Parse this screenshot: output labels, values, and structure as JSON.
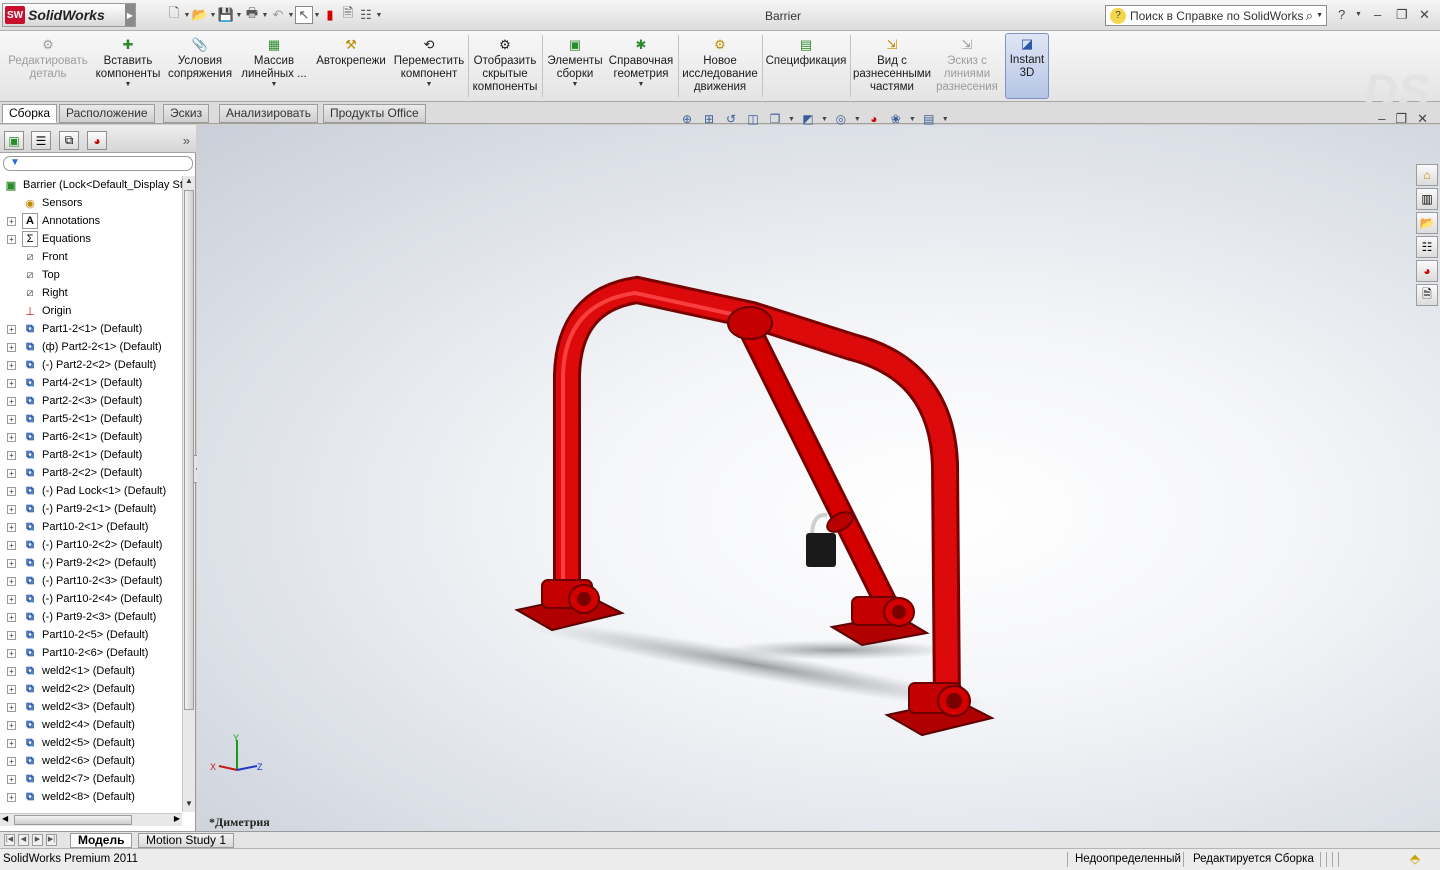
{
  "app": {
    "name": "SolidWorks",
    "logo_text": "SW",
    "window_title": "Barrier"
  },
  "help_search": {
    "placeholder": "Поиск в Справке по SolidWorks"
  },
  "ribbon": {
    "buttons": [
      {
        "label": "Редактировать деталь",
        "icon": "edit-part-icon",
        "disabled": true
      },
      {
        "label": "Вставить компоненты",
        "icon": "insert-component-icon"
      },
      {
        "label": "Условия сопряжения",
        "icon": "mate-icon"
      },
      {
        "label": "Массив линейных ...",
        "icon": "linear-pattern-icon"
      },
      {
        "label": "Автокрепежи",
        "icon": "smart-fasteners-icon"
      },
      {
        "label": "Переместить компонент",
        "icon": "move-component-icon"
      },
      {
        "label": "Отобразить скрытые компоненты",
        "icon": "show-hidden-icon"
      },
      {
        "label": "Элементы сборки",
        "icon": "assembly-features-icon"
      },
      {
        "label": "Справочная геометрия",
        "icon": "reference-geometry-icon"
      },
      {
        "label": "Новое исследование движения",
        "icon": "motion-study-icon"
      },
      {
        "label": "Спецификация",
        "icon": "bom-icon"
      },
      {
        "label": "Вид с разнесенными частями",
        "icon": "exploded-view-icon"
      },
      {
        "label": "Эскиз с линиями разнесения",
        "icon": "explode-line-sketch-icon",
        "disabled": true
      },
      {
        "label": "Instant 3D",
        "icon": "instant3d-icon",
        "active": true
      }
    ]
  },
  "tabs": [
    "Сборка",
    "Расположение",
    "Эскиз",
    "Анализировать",
    "Продукты Office"
  ],
  "tree": {
    "root": "Barrier  (Lock<Default_Display St",
    "items": [
      {
        "label": "Sensors",
        "type": "sensors"
      },
      {
        "label": "Annotations",
        "type": "annotations"
      },
      {
        "label": "Equations",
        "type": "equations"
      },
      {
        "label": "Front",
        "type": "plane"
      },
      {
        "label": "Top",
        "type": "plane"
      },
      {
        "label": "Right",
        "type": "plane"
      },
      {
        "label": "Origin",
        "type": "origin"
      },
      {
        "label": "Part1-2<1> (Default)",
        "type": "part"
      },
      {
        "label": "(ф) Part2-2<1> (Default)",
        "type": "part"
      },
      {
        "label": "(-) Part2-2<2> (Default)",
        "type": "part"
      },
      {
        "label": "Part4-2<1> (Default)",
        "type": "part"
      },
      {
        "label": "Part2-2<3> (Default)",
        "type": "part"
      },
      {
        "label": "Part5-2<1> (Default)",
        "type": "part"
      },
      {
        "label": "Part6-2<1> (Default)",
        "type": "part"
      },
      {
        "label": "Part8-2<1> (Default)",
        "type": "part"
      },
      {
        "label": "Part8-2<2> (Default)",
        "type": "part"
      },
      {
        "label": "(-) Pad Lock<1> (Default)",
        "type": "part"
      },
      {
        "label": "(-) Part9-2<1> (Default)",
        "type": "part"
      },
      {
        "label": "Part10-2<1> (Default)",
        "type": "part"
      },
      {
        "label": "(-) Part10-2<2> (Default)",
        "type": "part"
      },
      {
        "label": "(-) Part9-2<2> (Default)",
        "type": "part"
      },
      {
        "label": "(-) Part10-2<3> (Default)",
        "type": "part"
      },
      {
        "label": "(-) Part10-2<4> (Default)",
        "type": "part"
      },
      {
        "label": "(-) Part9-2<3> (Default)",
        "type": "part"
      },
      {
        "label": "Part10-2<5> (Default)",
        "type": "part"
      },
      {
        "label": "Part10-2<6> (Default)",
        "type": "part"
      },
      {
        "label": "weld2<1> (Default)",
        "type": "part"
      },
      {
        "label": "weld2<2> (Default)",
        "type": "part"
      },
      {
        "label": "weld2<3> (Default)",
        "type": "part"
      },
      {
        "label": "weld2<4> (Default)",
        "type": "part"
      },
      {
        "label": "weld2<5> (Default)",
        "type": "part"
      },
      {
        "label": "weld2<6> (Default)",
        "type": "part"
      },
      {
        "label": "weld2<7> (Default)",
        "type": "part"
      },
      {
        "label": "weld2<8> (Default)",
        "type": "part"
      }
    ]
  },
  "viewport": {
    "view_name": "*Диметрия",
    "axes": {
      "x": "X",
      "y": "Y",
      "z": "Z"
    },
    "model_color": "#d40000"
  },
  "bottom_tabs": [
    "Модель",
    "Motion Study 1"
  ],
  "status": {
    "product": "SolidWorks Premium 2011",
    "definition": "Недоопределенный",
    "mode": "Редактируется Сборка"
  }
}
